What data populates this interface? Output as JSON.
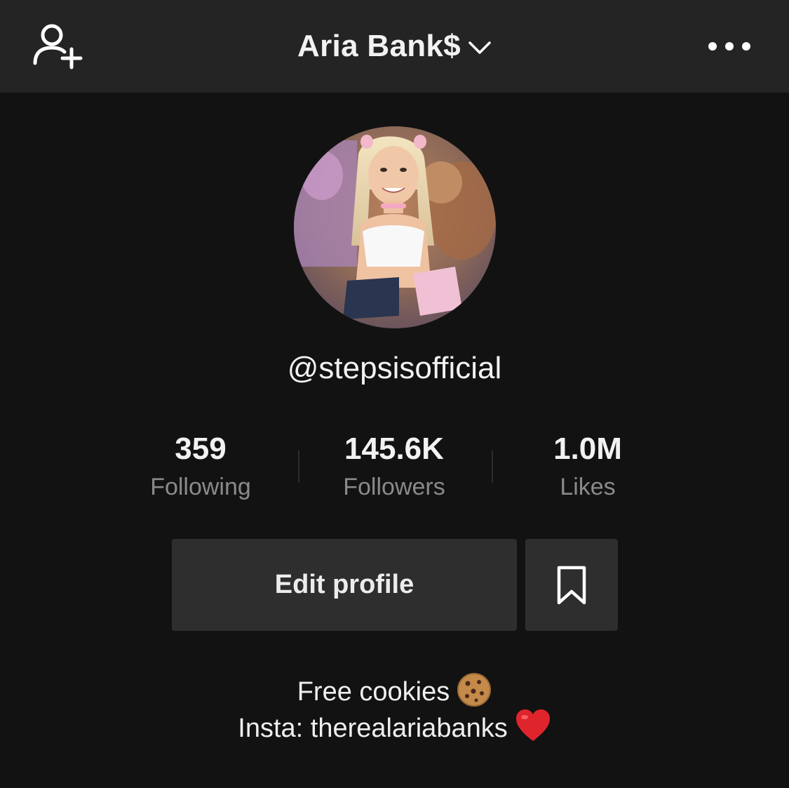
{
  "header": {
    "title": "Aria Bank$",
    "icons": {
      "left": "add-user-icon",
      "title_dropdown": "chevron-down-icon",
      "right": "more-icon"
    }
  },
  "profile": {
    "avatar_icon": "profile-photo",
    "handle": "@stepsisofficial"
  },
  "stats": [
    {
      "value": "359",
      "label": "Following"
    },
    {
      "value": "145.6K",
      "label": "Followers"
    },
    {
      "value": "1.0M",
      "label": "Likes"
    }
  ],
  "actions": {
    "edit_profile_label": "Edit profile",
    "bookmark_icon": "bookmark-icon"
  },
  "bio": {
    "line1": "Free cookies",
    "line1_emoji": "cookie-emoji",
    "line2": "Insta: therealariabanks",
    "line2_emoji": "red-heart-emoji"
  },
  "colors": {
    "background": "#121212",
    "topbar": "#242424",
    "button": "#2e2e2e",
    "secondary_text": "#8a8a8a"
  }
}
